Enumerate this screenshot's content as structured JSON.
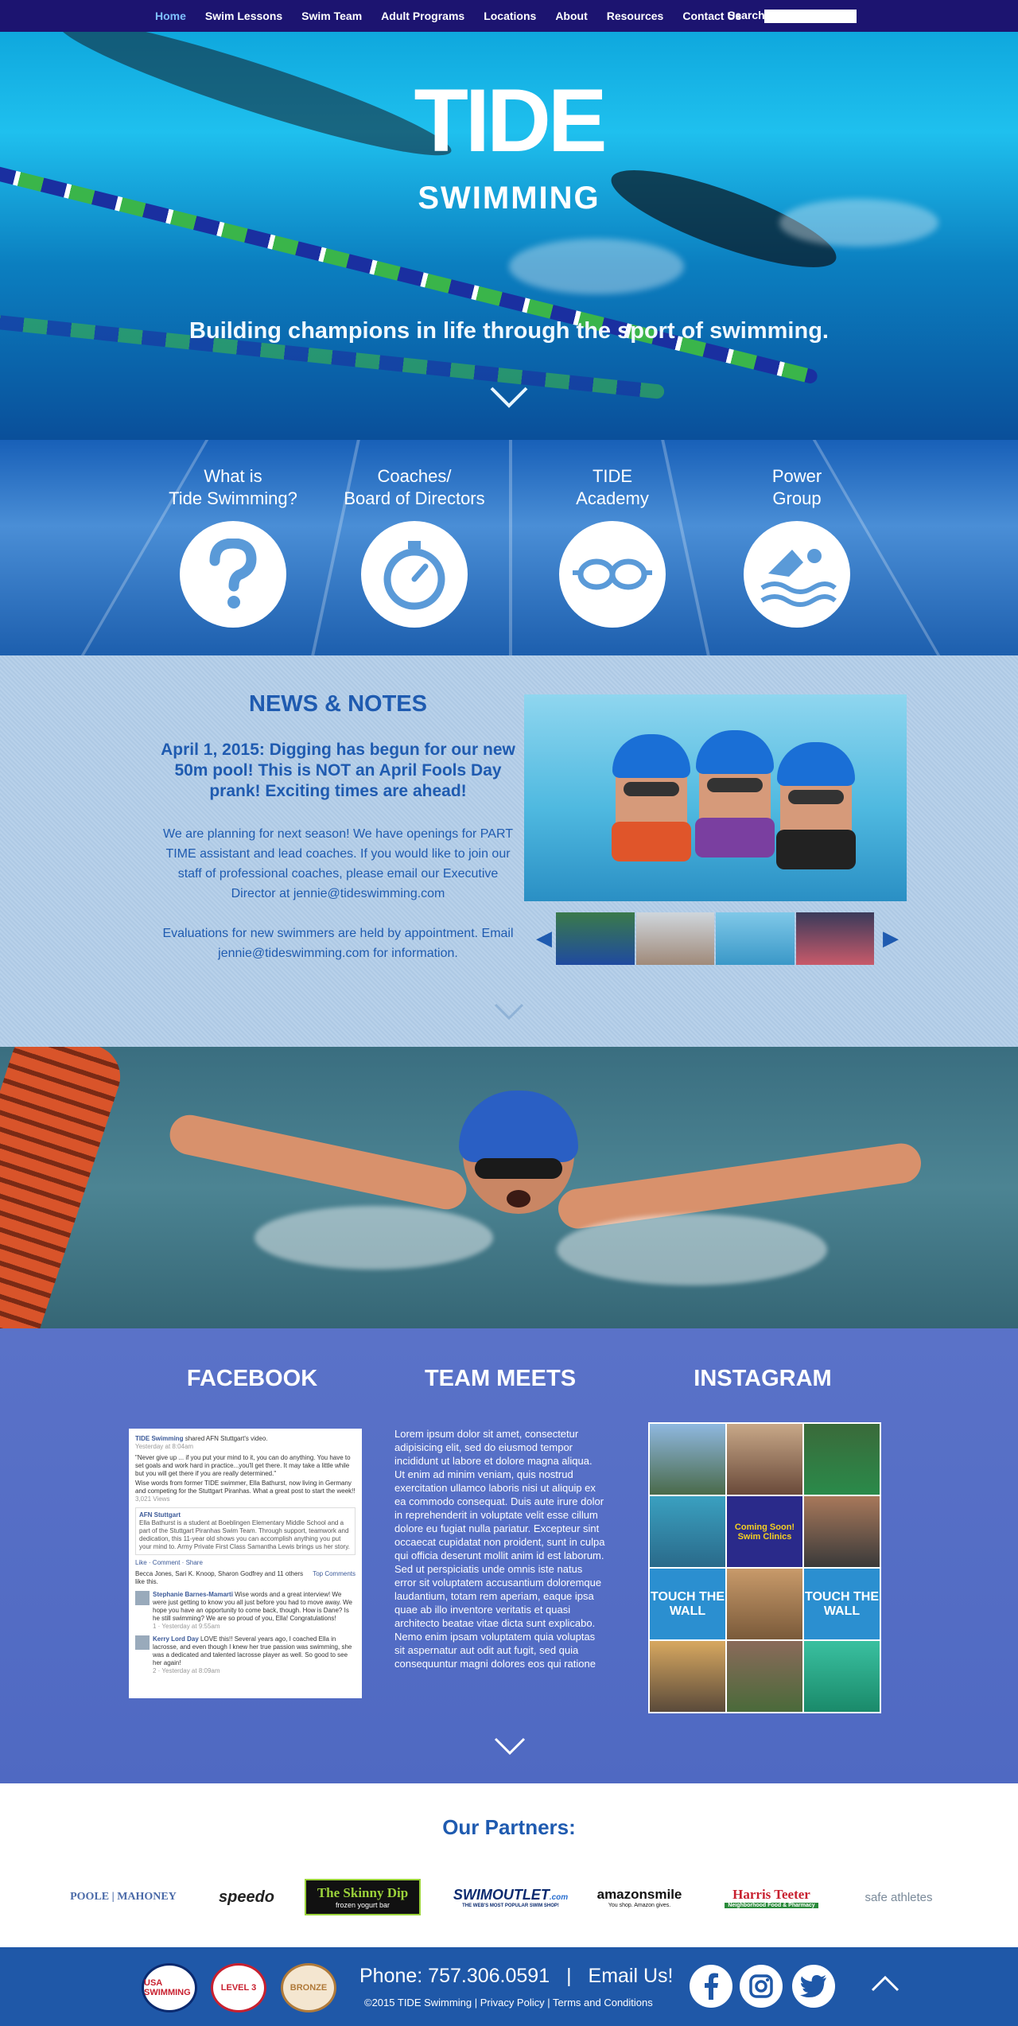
{
  "nav": {
    "items": [
      {
        "label": "Home",
        "active": true
      },
      {
        "label": "Swim Lessons"
      },
      {
        "label": "Swim Team"
      },
      {
        "label": "Adult Programs"
      },
      {
        "label": "Locations"
      },
      {
        "label": "About"
      },
      {
        "label": "Resources"
      },
      {
        "label": "Contact Us"
      }
    ],
    "search_label": "Search",
    "search_value": ""
  },
  "hero": {
    "logo_word": "TIDE",
    "logo_sub": "SWIMMING",
    "tagline": "Building champions in life through the sport of swimming."
  },
  "features": [
    {
      "line1": "What is",
      "line2": "Tide Swimming?",
      "icon": "question-icon"
    },
    {
      "line1": "Coaches/",
      "line2": "Board of Directors",
      "icon": "stopwatch-icon"
    },
    {
      "line1": "TIDE",
      "line2": "Academy",
      "icon": "goggles-icon"
    },
    {
      "line1": "Power",
      "line2": "Group",
      "icon": "swimmer-icon"
    }
  ],
  "news": {
    "title": "NEWS & NOTES",
    "headline": "April 1, 2015: Digging has begun for our new 50m pool! This is NOT an April Fools Day prank! Exciting times are ahead!",
    "body": "We are planning for next season! We have openings for PART TIME assistant and lead coaches. If you would like to join our staff of professional coaches, please email our Executive Director at jennie@tideswimming.com",
    "body2": "Evaluations for new swimmers are held by appointment. Email jennie@tideswimming.com for information."
  },
  "social": {
    "facebook_heading": "FACEBOOK",
    "meets_heading": "TEAM MEETS",
    "instagram_heading": "INSTAGRAM",
    "fb": {
      "page_name": "TIDE Swimming",
      "shared": "shared AFN Stuttgart's video.",
      "time": "Yesterday at 8:04am",
      "post": "\"Never give up ... if you put your mind to it, you can do anything. You have to set goals and work hard in practice...you'll get there. It may take a little while but you will get there if you are really determined.\"",
      "post2": "Wise words from former TIDE swimmer, Ella Bathurst, now living in Germany and competing for the Stuttgart Piranhas. What a great post to start the week!!",
      "views": "3,021 Views",
      "inner_title": "AFN Stuttgart",
      "inner_text": "Ella Bathurst is a student at Boeblingen Elementary Middle School and a part of the Stuttgart Piranhas Swim Team. Through support, teamwork and dedication, this 11-year old shows you can accomplish anything you put your mind to. Army Private First Class Samantha Lewis brings us her story.",
      "actions": "Like · Comment · Share",
      "likes": "Becca Jones, Sari K. Knoop, Sharon Godfrey and 11 others like this.",
      "top_comments": "Top Comments",
      "c1_name": "Stephanie Barnes-Mamarti",
      "c1_text": "Wise words and a great interview! We were just getting to know you all just before you had to move away. We hope you have an opportunity to come back, though. How is Dane? Is he still swimming? We are so proud of you, Ella! Congratulations!",
      "c1_meta": "1 · Yesterday at 9:55am",
      "c2_name": "Kerry Lord Day",
      "c2_text": "LOVE this!! Several years ago, I coached Ella in lacrosse, and even though I knew her true passion was swimming, she was a dedicated and talented lacrosse player as well. So good to see her again!",
      "c2_meta": "2 · Yesterday at 8:09am"
    },
    "meets_text": "Lorem ipsum dolor sit amet, consectetur adipisicing elit, sed do eiusmod tempor incididunt ut labore et dolore magna aliqua. Ut enim ad minim veniam, quis nostrud exercitation ullamco laboris nisi ut aliquip ex ea commodo consequat. Duis aute irure dolor in reprehenderit in voluptate velit esse cillum dolore eu fugiat nulla pariatur. Excepteur sint occaecat cupidatat non proident, sunt in culpa qui officia deserunt mollit anim id est laborum. Sed ut perspiciatis unde omnis iste natus error sit voluptatem accusantium doloremque laudantium, totam rem aperiam, eaque ipsa quae ab illo inventore veritatis et quasi architecto beatae vitae dicta sunt explicabo. Nemo enim ipsam voluptatem quia voluptas sit aspernatur aut odit aut fugit, sed quia consequuntur magni dolores eos qui ratione",
    "insta_overlay_1": "Coming Soon!",
    "insta_overlay_2": "Swim Clinics",
    "insta_touch": "TOUCH THE WALL"
  },
  "partners": {
    "heading": "Our Partners:",
    "logos": [
      {
        "name": "POOLE | MAHONEY",
        "color": "#4a6aa8"
      },
      {
        "name": "speedo",
        "color": "#222222"
      },
      {
        "name": "The Skinny Dip",
        "sub": "frozen yogurt bar",
        "color": "#9bd23a"
      },
      {
        "name": "SWIMOUTLET",
        "sub": ".com",
        "tag": "THE WEB'S MOST POPULAR SWIM SHOP!",
        "color": "#0b2a6f"
      },
      {
        "name": "amazonsmile",
        "sub": "You shop. Amazon gives.",
        "color": "#111111"
      },
      {
        "name": "Harris Teeter",
        "sub": "Neighborhood Food & Pharmacy",
        "color": "#c8202f"
      },
      {
        "name": "safe athletes",
        "color": "#7a8a9a"
      }
    ]
  },
  "footer": {
    "badges": [
      "USA SWIMMING",
      "LEVEL 3",
      "BRONZE"
    ],
    "phone": "Phone: 757.306.0591",
    "separator": "|",
    "email": "Email Us!",
    "copyright": "©2015 TIDE Swimming",
    "privacy": "Privacy Policy",
    "terms": "Terms and Conditions"
  },
  "colors": {
    "nav_bg": "#1c1470",
    "brand_blue": "#1f5bb0",
    "social_bg": "#5a72c8"
  }
}
